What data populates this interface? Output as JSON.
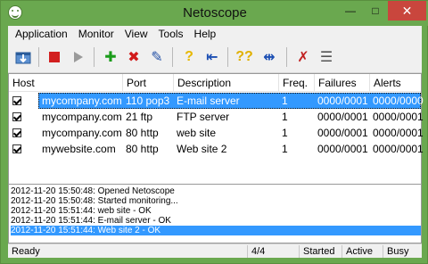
{
  "window": {
    "title": "Netoscope"
  },
  "menu": {
    "items": [
      "Application",
      "Monitor",
      "View",
      "Tools",
      "Help"
    ]
  },
  "toolbar": {
    "icons": [
      "import-icon",
      "stop-icon",
      "play-icon",
      "add-icon",
      "delete-icon",
      "edit-icon",
      "help-icon",
      "back-icon",
      "help-all-icon",
      "align-icon",
      "mute-icon",
      "list-icon"
    ]
  },
  "table": {
    "columns": [
      "Host",
      "Port",
      "Description",
      "Freq.",
      "Failures",
      "Alerts"
    ],
    "rows": [
      {
        "host": "mycompany.com",
        "port": "110 pop3",
        "description": "E-mail server",
        "freq": "1",
        "failures": "0000/0001",
        "alerts": "0000/0000",
        "selected": true
      },
      {
        "host": "mycompany.com",
        "port": "21 ftp",
        "description": "FTP server",
        "freq": "1",
        "failures": "0000/0001",
        "alerts": "0000/0001",
        "selected": false
      },
      {
        "host": "mycompany.com",
        "port": "80 http",
        "description": "web site",
        "freq": "1",
        "failures": "0000/0001",
        "alerts": "0000/0001",
        "selected": false
      },
      {
        "host": "mywebsite.com",
        "port": "80 http",
        "description": "Web site 2",
        "freq": "1",
        "failures": "0000/0001",
        "alerts": "0000/0001",
        "selected": false
      }
    ]
  },
  "log": {
    "lines": [
      "2012-11-20 15:50:48: Opened Netoscope",
      "2012-11-20 15:50:48: Started monitoring...",
      "2012-11-20 15:51:44: web site - OK",
      "2012-11-20 15:51:44: E-mail server - OK",
      "2012-11-20 15:51:44: Web site 2 - OK"
    ],
    "selected_index": 4
  },
  "status": {
    "ready": "Ready",
    "count": "4/4",
    "state": "Started",
    "active": "Active",
    "busy": "Busy"
  }
}
